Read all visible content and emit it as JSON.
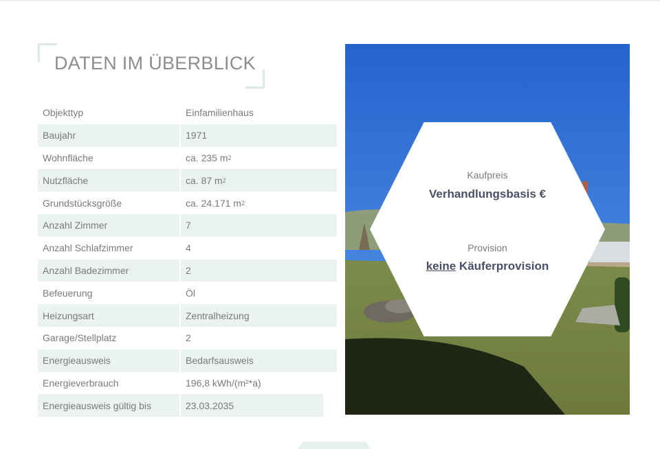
{
  "section": {
    "title": "DATEN IM ÜBERBLICK"
  },
  "details": [
    {
      "label": "Objekttyp",
      "value": "Einfamilienhaus"
    },
    {
      "label": "Baujahr",
      "value": "1971"
    },
    {
      "label": "Wohnfläche",
      "value": "ca. 235 m",
      "sup": "2"
    },
    {
      "label": "Nutzfläche",
      "value": "ca. 87 m",
      "sup": "2"
    },
    {
      "label": "Grundstücksgröße",
      "value": "ca. 24.171 m",
      "sup": "2"
    },
    {
      "label": "Anzahl Zimmer",
      "value": "7"
    },
    {
      "label": "Anzahl Schlafzimmer",
      "value": "4"
    },
    {
      "label": "Anzahl Badezimmer",
      "value": "2"
    },
    {
      "label": "Befeuerung",
      "value": "Öl"
    },
    {
      "label": "Heizungsart",
      "value": "Zentralheizung"
    },
    {
      "label": "Garage/Stellplatz",
      "value": "2"
    },
    {
      "label": "Energieausweis",
      "value": "Bedarfsausweis"
    },
    {
      "label": "Energieverbrauch",
      "value": "196,8 kWh/(m²*a)"
    },
    {
      "label": "Energieausweis gültig bis",
      "value": "23.03.2035"
    }
  ],
  "pricing": {
    "price_label": "Kaufpreis",
    "price_value": "Verhandlungsbasis €",
    "commission_label": "Provision",
    "commission_link": "keine",
    "commission_rest": " Käuferprovision"
  },
  "colors": {
    "stripe": "#eaf3ef",
    "accent_frame": "#dbe9e3",
    "sky": "#2e6fd6",
    "text_dark": "#4a4f66"
  }
}
